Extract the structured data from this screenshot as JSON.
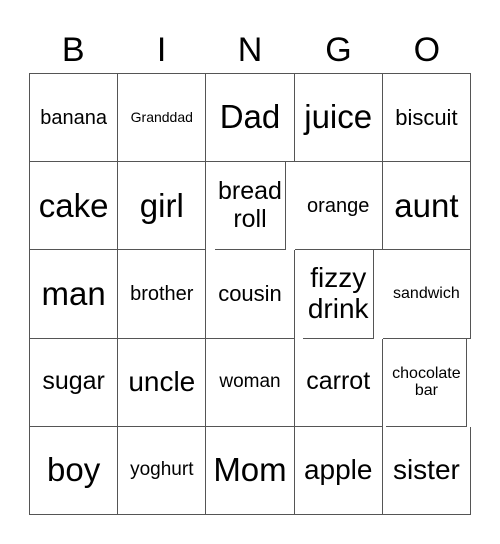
{
  "title_letters": [
    "B",
    "I",
    "N",
    "G",
    "O"
  ],
  "cells": [
    [
      "banana",
      "Granddad",
      "Dad",
      "juice",
      "biscuit"
    ],
    [
      "cake",
      "girl",
      "bread roll",
      "orange",
      "aunt"
    ],
    [
      "man",
      "brother",
      "cousin",
      "fizzy drink",
      "sandwich"
    ],
    [
      "sugar",
      "uncle",
      "woman",
      "carrot",
      "chocolate bar"
    ],
    [
      "boy",
      "yoghurt",
      "Mom",
      "apple",
      "sister"
    ]
  ]
}
